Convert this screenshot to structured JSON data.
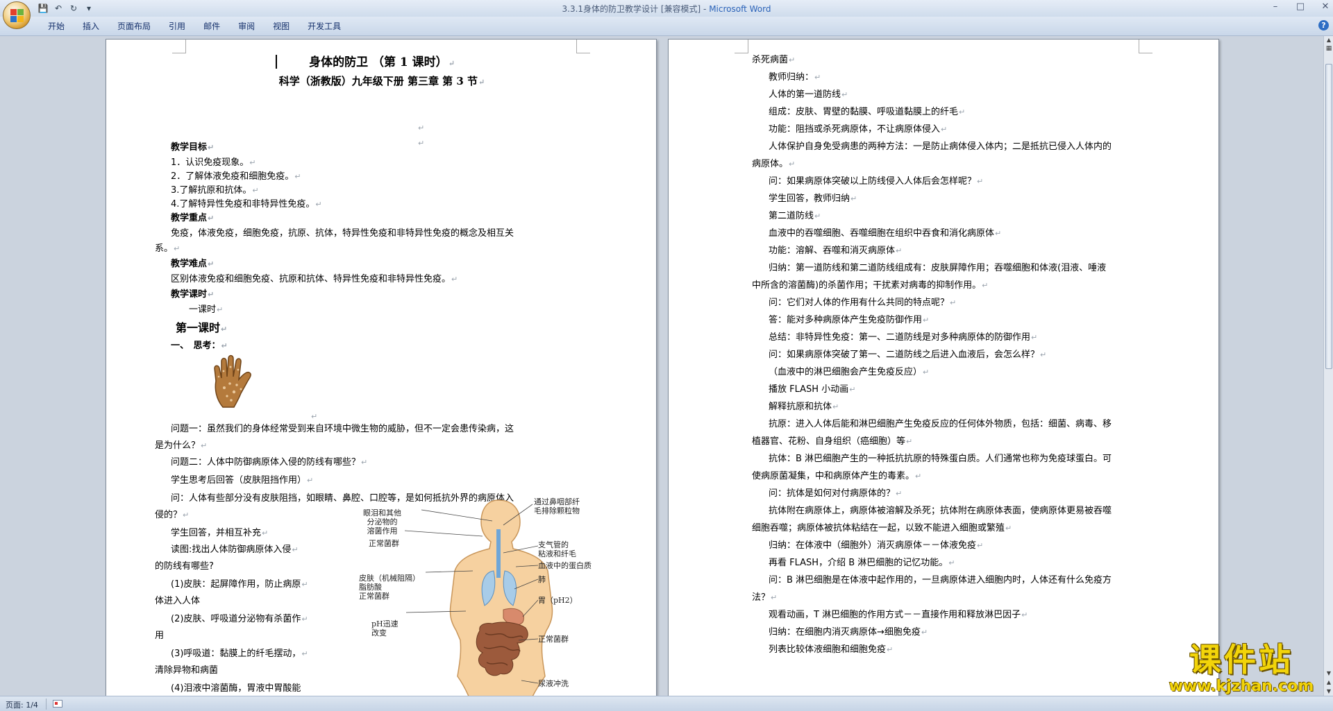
{
  "window": {
    "title": "3.3.1身体的防卫教学设计 [兼容模式] - ",
    "app_name": "Microsoft Word",
    "quick_access": [
      "save-icon",
      "undo-icon",
      "redo-icon",
      "customize-icon"
    ]
  },
  "ribbon": {
    "tabs": [
      "开始",
      "插入",
      "页面布局",
      "引用",
      "邮件",
      "审阅",
      "视图",
      "开发工具"
    ],
    "help": "?"
  },
  "page1": {
    "title": "身体的防卫 （第 1 课时）",
    "subtitle": "科学（浙教版）九年级下册 第三章 第 3 节",
    "lines": [
      "",
      "",
      "教学目标",
      "1．认识免疫现象。",
      "2．了解体液免疫和细胞免疫。",
      "3.了解抗原和抗体。",
      "4.了解特异性免疫和非特异性免疫。",
      "教学重点",
      "免疫，体液免疫，细胞免疫，抗原、抗体，特异性免疫和非特异性免疫的概念及相互关",
      "系。",
      "教学难点",
      "区别体液免疫和细胞免疫、抗原和抗体、特异性免疫和非特异性免疫。",
      "教学课时",
      "一课时",
      "第一课时",
      "一、　思考：",
      "",
      "问题一：虽然我们的身体经常受到来自环境中微生物的威胁，但不一定会患传染病，这",
      "是为什么？",
      "问题二：人体中防御病原体入侵的防线有哪些？",
      "学生思考后回答（皮肤阻挡作用）",
      "问：人体有些部分没有皮肤阻挡，如眼睛、鼻腔、口腔等，是如何抵抗外界的病原体入",
      "侵的？",
      "学生回答，并相互补充",
      "读图:找出人体防御病原体入侵",
      "的防线有哪些?",
      "(1)皮肤：起屏障作用，防止病原",
      "体进入人体",
      "(2)皮肤、呼吸道分泌物有杀菌作",
      "用",
      "(3)呼吸道：黏膜上的纤毛摆动，",
      "清除异物和病菌",
      "(4)泪液中溶菌酶，胃液中胃酸能"
    ],
    "diagram_labels": [
      "眼泪和其他\n分泌物的\n溶菌作用",
      "正常菌群",
      "皮肤（机械阻隔）\n脂肪酸\n正常菌群",
      "pH迅速\n改变",
      "通过鼻咽部纤\n毛排除颗粒物",
      "支气管的\n粘液和纤毛",
      "血液中的蛋白质",
      "肺",
      "胃（pH2）",
      "正常菌群",
      "尿液冲洗"
    ]
  },
  "page2": {
    "lines": [
      "杀死病菌",
      "教师归纳：",
      "人体的第一道防线",
      "组成：皮肤、胃壁的黏膜、呼吸道黏膜上的纤毛",
      "功能：阻挡或杀死病原体，不让病原体侵入",
      "人体保护自身免受病患的两种方法：一是防止病体侵入体内；二是抵抗已侵入人体内的",
      "病原体。",
      "问：如果病原体突破以上防线侵入人体后会怎样呢？",
      "学生回答，教师归纳",
      "第二道防线",
      "血液中的吞噬细胞、吞噬细胞在组织中吞食和消化病原体",
      "功能：溶解、吞噬和消灭病原体",
      "归纳：第一道防线和第二道防线组成有：皮肤屏障作用；吞噬细胞和体液(泪液、唾液",
      "中所含的溶菌酶)的杀菌作用；干扰素对病毒的抑制作用。",
      "问：它们对人体的作用有什么共同的特点呢？",
      "答：能对多种病原体产生免疫防御作用",
      "总结：非特异性免疫：第一、二道防线是对多种病原体的防御作用",
      "问：如果病原体突破了第一、二道防线之后进入血液后，会怎么样？",
      "（血液中的淋巴细胞会产生免疫反应）",
      "播放 FLASH 小动画",
      "解释抗原和抗体",
      "抗原：进入人体后能和淋巴细胞产生免疫反应的任何体外物质，包括：细菌、病毒、移",
      "植器官、花粉、自身组织（癌细胞）等",
      "抗体：B 淋巴细胞产生的一种抵抗抗原的特殊蛋白质。人们通常也称为免疫球蛋白。可",
      "使病原菌凝集，中和病原体产生的毒素。",
      "问：抗体是如何对付病原体的？",
      "抗体附在病原体上，病原体被溶解及杀死；抗体附在病原体表面，使病原体更易被吞噬",
      "细胞吞噬；病原体被抗体粘结在一起，以致不能进入细胞或繁殖",
      "归纳：在体液中（细胞外）消灭病原体－－体液免疫",
      "再看 FLASH，介绍 B 淋巴细胞的记忆功能。",
      "问：B 淋巴细胞是在体液中起作用的，一旦病原体进入细胞内时，人体还有什么免疫方",
      "法？",
      "观看动画，T 淋巴细胞的作用方式－－直接作用和释放淋巴因子",
      "归纳：在细胞内消灭病原体→细胞免疫",
      "列表比较体液细胞和细胞免疫"
    ]
  },
  "statusbar": {
    "page_info": "页面: 1/4"
  },
  "watermark": {
    "text": "课件站",
    "url": "www.kjzhan.com"
  }
}
